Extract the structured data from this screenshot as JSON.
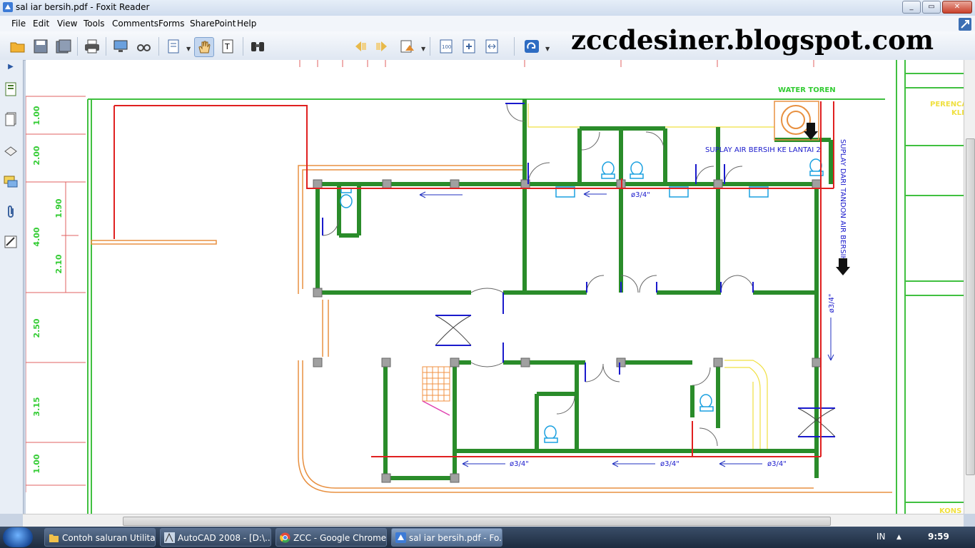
{
  "window": {
    "title": "sal iar bersih.pdf - Foxit Reader",
    "minimize": "_",
    "maximize": "▭",
    "close": "✕"
  },
  "menu": [
    "File",
    "Edit",
    "View",
    "Tools",
    "Comments",
    "Forms",
    "SharePoint",
    "Help"
  ],
  "toolbar": {
    "find_value": ""
  },
  "watermark": "zccdesiner.blogspot.com",
  "drawing": {
    "water_toren": "WATER TOREN",
    "suplay_lantai": "SUPLAY AIR BERSIH KE LANTAI 2",
    "suplay_tandon": "SUPLAY DARI TANDON AIR BERSIH",
    "pipe_label": "ø3/4\"",
    "title_block_1": "PERENCA",
    "title_block_2": "KLI",
    "title_block_3": "KONS",
    "dims_left": [
      "1.00",
      "2.00",
      "4.00",
      "2.50",
      "3.15",
      "1.00"
    ],
    "dims_right": [
      "1.90",
      "2.10"
    ]
  },
  "taskbar": {
    "tasks": [
      "Contoh saluran Utilitas",
      "AutoCAD 2008 - [D:\\...",
      "ZCC - Google Chrome",
      "sal iar bersih.pdf - Fo..."
    ],
    "lang": "IN",
    "clock": "9:59"
  }
}
